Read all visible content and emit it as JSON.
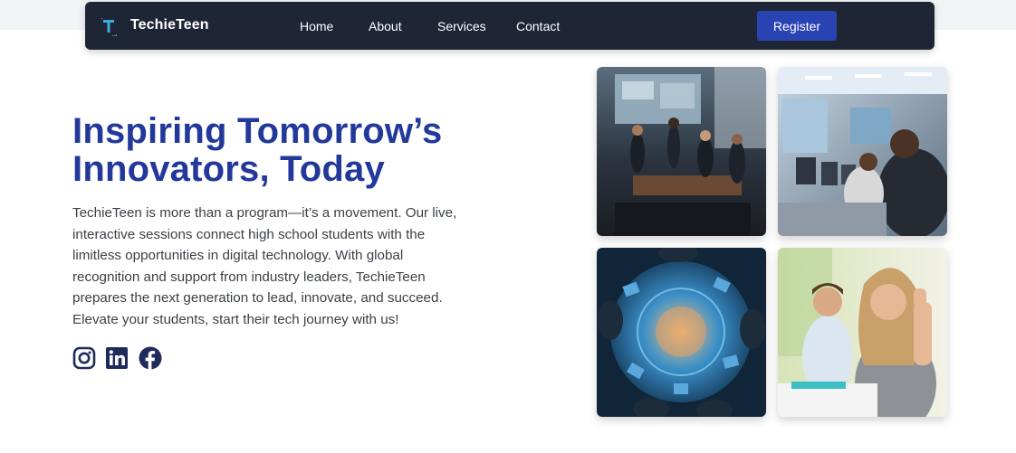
{
  "nav": {
    "brand": "TechieTeen",
    "links": [
      "Home",
      "About",
      "Services",
      "Contact"
    ],
    "register_label": "Register"
  },
  "hero": {
    "title_line1": "Inspiring Tomorrow’s",
    "title_line2": "Innovators, Today",
    "lines": [
      "TechieTeen is more than a program—it’s a movement. Our live,",
      "interactive sessions connect high school students with the",
      "limitless opportunities in digital technology. With global",
      "recognition and support from industry leaders, TechieTeen",
      "prepares the next generation to lead, innovate, and succeed.",
      "Elevate your students, start their tech journey with us!"
    ]
  },
  "socials": [
    "instagram-icon",
    "linkedin-icon",
    "facebook-icon"
  ],
  "images": [
    "photo-meeting-room",
    "photo-computer-lab",
    "photo-collaboration-table",
    "photo-student-thumbs-up"
  ],
  "colors": {
    "navbar_bg": "#1e2636",
    "accent": "#2a43b3",
    "title": "#23389b",
    "body_text": "#3b3f47",
    "icon": "#1e2b5c"
  }
}
